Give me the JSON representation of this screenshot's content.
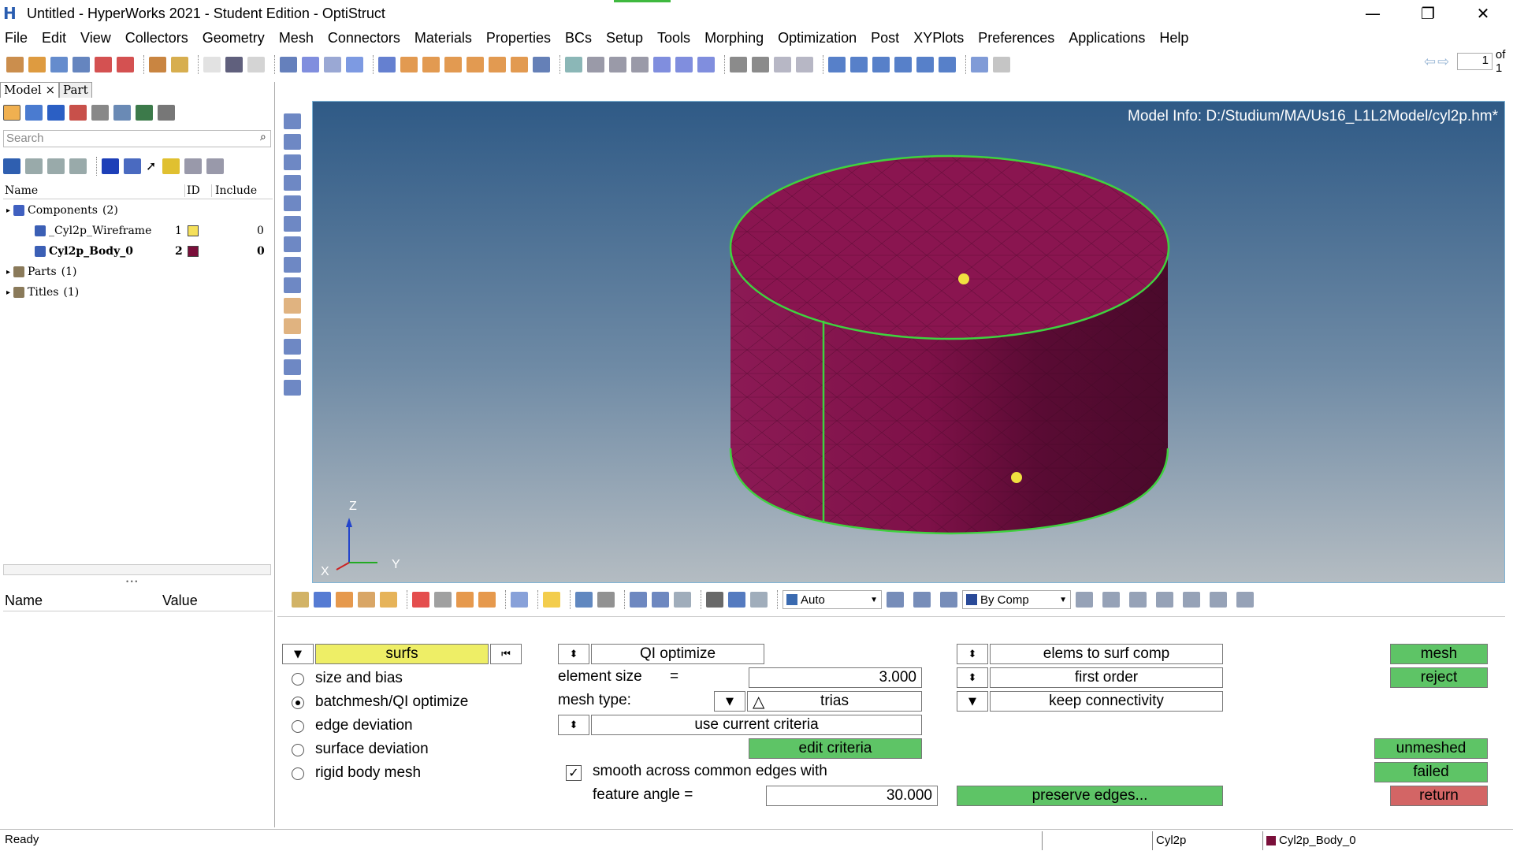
{
  "window": {
    "title": "Untitled - HyperWorks 2021 - Student Edition - OptiStruct",
    "logo_letter": "H",
    "minimize": "—",
    "restore": "❐",
    "close": "✕"
  },
  "menu": [
    "File",
    "Edit",
    "View",
    "Collectors",
    "Geometry",
    "Mesh",
    "Connectors",
    "Materials",
    "Properties",
    "BCs",
    "Setup",
    "Tools",
    "Morphing",
    "Optimization",
    "Post",
    "XYPlots",
    "Preferences",
    "Applications",
    "Help"
  ],
  "pager": {
    "page": "1",
    "of_label": "of 1"
  },
  "browser": {
    "tabs": [
      "Model",
      "Part"
    ],
    "tab_close": "×",
    "search_placeholder": "Search",
    "columns": {
      "name": "Name",
      "id": "ID",
      "include": "Include"
    },
    "tree": [
      {
        "label": "Components",
        "count": "(2)",
        "icon": "components-icon"
      },
      {
        "label": "_Cyl2p_Wireframe",
        "id": "1",
        "color": "#f5e05a",
        "include": "0"
      },
      {
        "label": "Cyl2p_Body_0",
        "id": "2",
        "color": "#7a0f3a",
        "include": "0"
      },
      {
        "label": "Parts",
        "count": "(1)",
        "icon": "parts-icon"
      },
      {
        "label": "Titles",
        "count": "(1)",
        "icon": "titles-icon"
      }
    ],
    "props_columns": {
      "name": "Name",
      "value": "Value"
    },
    "splitter": "• • •"
  },
  "viewport": {
    "model_info": "Model Info: D:/Studium/MA/Us16_L1L2Model/cyl2p.hm*",
    "axis_labels": {
      "z": "Z",
      "x": "X",
      "y": "Y"
    },
    "body_color": "#8a1550",
    "edge_color": "#3fd23f"
  },
  "view_toolbar": {
    "auto_label": "Auto",
    "bycomp_label": "By Comp"
  },
  "panel": {
    "entity": "surfs",
    "options": [
      {
        "label": "size and bias",
        "selected": false
      },
      {
        "label": "batchmesh/QI optimize",
        "selected": true
      },
      {
        "label": "edge deviation",
        "selected": false
      },
      {
        "label": "surface deviation",
        "selected": false
      },
      {
        "label": "rigid body mesh",
        "selected": false
      }
    ],
    "qi_optimize": "QI optimize",
    "element_size_label": "element size",
    "equals": "=",
    "element_size": "3.000",
    "mesh_type_label": "mesh type:",
    "mesh_type": "trias",
    "criteria_mode": "use current criteria",
    "edit_criteria": "edit criteria",
    "smooth_label": "smooth across common edges with",
    "smooth_checked": true,
    "feature_angle_label": "feature angle =",
    "feature_angle": "30.000",
    "elems_to": "elems to surf comp",
    "order": "first order",
    "connectivity": "keep connectivity",
    "preserve_edges": "preserve edges...",
    "mesh": "mesh",
    "reject": "reject",
    "unmeshed": "unmeshed",
    "failed": "failed",
    "return": "return"
  },
  "status": {
    "text": "Ready",
    "seg1": "Cyl2p",
    "seg2": "Cyl2p_Body_0",
    "seg2_color": "#7a0f3a"
  }
}
